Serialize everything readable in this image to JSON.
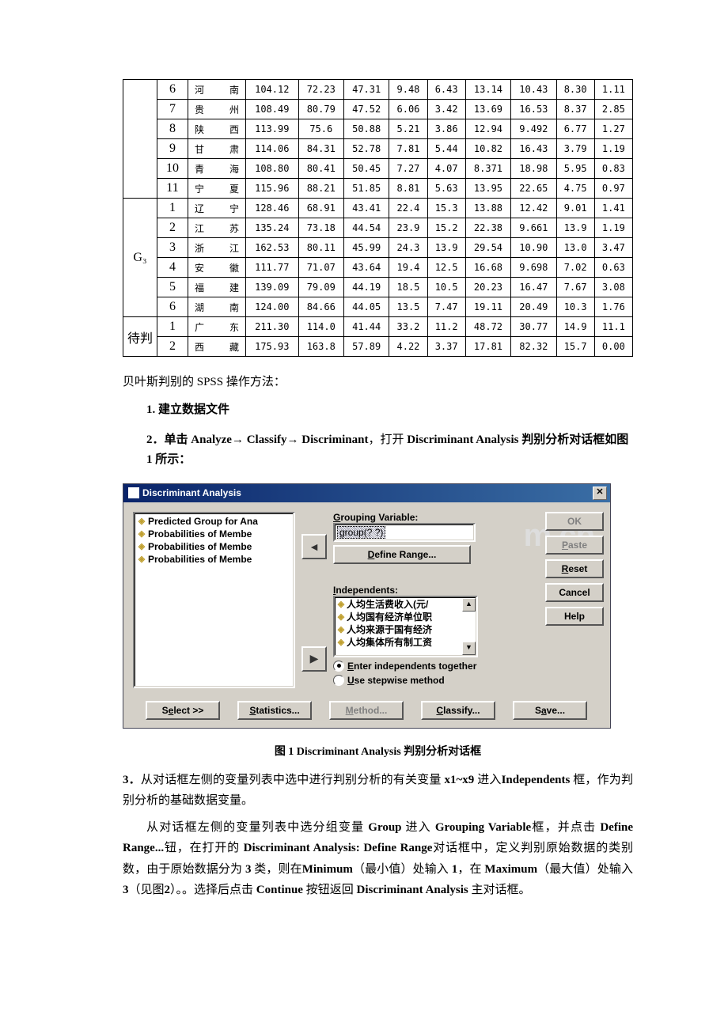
{
  "table": {
    "groups": [
      {
        "label": "",
        "rows": [
          {
            "idx": "6",
            "prov": "河　　南",
            "c": [
              "104.12",
              "72.23",
              "47.31",
              "9.48",
              "6.43",
              "13.14",
              "10.43",
              "8.30",
              "1.11"
            ]
          },
          {
            "idx": "7",
            "prov": "贵　　州",
            "c": [
              "108.49",
              "80.79",
              "47.52",
              "6.06",
              "3.42",
              "13.69",
              "16.53",
              "8.37",
              "2.85"
            ]
          },
          {
            "idx": "8",
            "prov": "陕　　西",
            "c": [
              "113.99",
              "75.6",
              "50.88",
              "5.21",
              "3.86",
              "12.94",
              "9.492",
              "6.77",
              "1.27"
            ]
          },
          {
            "idx": "9",
            "prov": "甘　　肃",
            "c": [
              "114.06",
              "84.31",
              "52.78",
              "7.81",
              "5.44",
              "10.82",
              "16.43",
              "3.79",
              "1.19"
            ]
          },
          {
            "idx": "10",
            "prov": "青　　海",
            "c": [
              "108.80",
              "80.41",
              "50.45",
              "7.27",
              "4.07",
              "8.371",
              "18.98",
              "5.95",
              "0.83"
            ]
          },
          {
            "idx": "11",
            "prov": "宁　　夏",
            "c": [
              "115.96",
              "88.21",
              "51.85",
              "8.81",
              "5.63",
              "13.95",
              "22.65",
              "4.75",
              "0.97"
            ]
          }
        ]
      },
      {
        "label": "G₃",
        "rows": [
          {
            "idx": "1",
            "prov": "辽　　宁",
            "c": [
              "128.46",
              "68.91",
              "43.41",
              "22.4",
              "15.3",
              "13.88",
              "12.42",
              "9.01",
              "1.41"
            ]
          },
          {
            "idx": "2",
            "prov": "江　　苏",
            "c": [
              "135.24",
              "73.18",
              "44.54",
              "23.9",
              "15.2",
              "22.38",
              "9.661",
              "13.9",
              "1.19"
            ]
          },
          {
            "idx": "3",
            "prov": "浙　　江",
            "c": [
              "162.53",
              "80.11",
              "45.99",
              "24.3",
              "13.9",
              "29.54",
              "10.90",
              "13.0",
              "3.47"
            ]
          },
          {
            "idx": "4",
            "prov": "安　　徽",
            "c": [
              "111.77",
              "71.07",
              "43.64",
              "19.4",
              "12.5",
              "16.68",
              "9.698",
              "7.02",
              "0.63"
            ]
          },
          {
            "idx": "5",
            "prov": "福　　建",
            "c": [
              "139.09",
              "79.09",
              "44.19",
              "18.5",
              "10.5",
              "20.23",
              "16.47",
              "7.67",
              "3.08"
            ]
          },
          {
            "idx": "6",
            "prov": "湖　　南",
            "c": [
              "124.00",
              "84.66",
              "44.05",
              "13.5",
              "7.47",
              "19.11",
              "20.49",
              "10.3",
              "1.76"
            ]
          }
        ]
      },
      {
        "label": "待判",
        "rows": [
          {
            "idx": "1",
            "prov": "广　　东",
            "c": [
              "211.30",
              "114.0",
              "41.44",
              "33.2",
              "11.2",
              "48.72",
              "30.77",
              "14.9",
              "11.1"
            ]
          },
          {
            "idx": "2",
            "prov": "西　　藏",
            "c": [
              "175.93",
              "163.8",
              "57.89",
              "4.22",
              "3.37",
              "17.81",
              "82.32",
              "15.7",
              "0.00"
            ]
          }
        ]
      }
    ]
  },
  "text": {
    "section_title": "贝叶斯判别的 SPSS 操作方法：",
    "step1_prefix": "1. ",
    "step1": "建立数据文件",
    "step2_prefix": "2．单击 ",
    "step2_a": "Analyze",
    "step2_arrow": "→ ",
    "step2_b": "Classify",
    "step2_c": "Discriminant",
    "step2_tail": "，打开 ",
    "step2_d": "Discriminant Analysis ",
    "step2_e": "判别分析对话框如图 1 所示：",
    "caption1": "图 1    Discriminant Analysis 判别分析对话框",
    "step3": "3．从对话框左侧的变量列表中选中进行判别分析的有关变量 x1~x9 进入Independents  框，作为判别分析的基础数据变量。",
    "para2": "从对话框左侧的变量列表中选分组变量 Group 进入 Grouping Variable框，并点击 Define Range...钮，在打开的 Discriminant Analysis: Define Range对话框中，定义判别原始数据的类别数，由于原始数据分为 3 类，则在Minimum（最小值）处输入 1，在 Maximum（最大值）处输入 3（见图2）。。选择后点击 Continue 按钮返回 Discriminant Analysis 主对话框。"
  },
  "dialog": {
    "title": "Discriminant Analysis",
    "close": "✕",
    "watermark": "m.cn",
    "left_items": [
      "Predicted Group for Ana",
      "Probabilities of Membe",
      "Probabilities of Membe",
      "Probabilities of Membe"
    ],
    "grouping_label_pre": "G",
    "grouping_label": "rouping Variable:",
    "grouping_value": "group(? ?)",
    "define_range_pre": "D",
    "define_range": "efine Range...",
    "independents_pre": "I",
    "independents_label": "ndependents:",
    "indep_items": [
      "人均生活费收入(元/",
      "人均国有经济单位职",
      "人均来源于国有经济",
      "人均集体所有制工资"
    ],
    "radio1_pre": "E",
    "radio1": "nter independents together",
    "radio2_pre": "U",
    "radio2": "se stepwise method",
    "side": {
      "ok": "OK",
      "paste_pre": "P",
      "paste": "aste",
      "reset_pre": "R",
      "reset": "eset",
      "cancel": "Cancel",
      "help": "Help"
    },
    "bottom": {
      "select_pre": "e",
      "select": "S",
      "select_post": "lect >>",
      "statistics_pre": "S",
      "statistics": "tatistics...",
      "method_pre": "M",
      "method": "ethod...",
      "classify_pre": "C",
      "classify": "lassify...",
      "save_pre": "a",
      "save": "S",
      "save_post": "ve..."
    }
  }
}
